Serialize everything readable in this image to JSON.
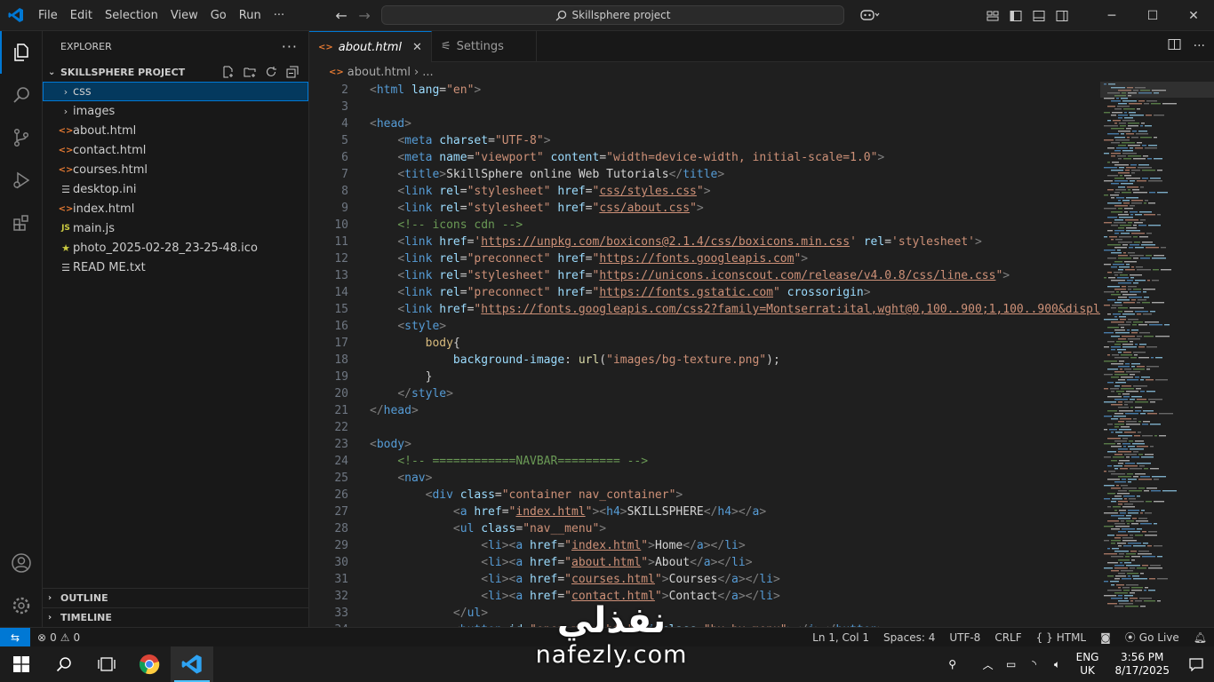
{
  "titlebar": {
    "menu": [
      "File",
      "Edit",
      "Selection",
      "View",
      "Go",
      "Run",
      "···"
    ],
    "search_text": "Skillsphere project"
  },
  "explorer": {
    "title": "EXPLORER",
    "more": "···",
    "project_name": "SKILLSPHERE PROJECT",
    "items": [
      {
        "label": "css",
        "kind": "folder",
        "selected": true
      },
      {
        "label": "images",
        "kind": "folder"
      },
      {
        "label": "about.html",
        "kind": "html"
      },
      {
        "label": "contact.html",
        "kind": "html"
      },
      {
        "label": "courses.html",
        "kind": "html"
      },
      {
        "label": "desktop.ini",
        "kind": "text"
      },
      {
        "label": "index.html",
        "kind": "html"
      },
      {
        "label": "main.js",
        "kind": "js"
      },
      {
        "label": "photo_2025-02-28_23-25-48.ico",
        "kind": "image"
      },
      {
        "label": "READ ME.txt",
        "kind": "text"
      }
    ],
    "outline": "OUTLINE",
    "timeline": "TIMELINE"
  },
  "tabs": [
    {
      "label": "about.html",
      "active": true
    },
    {
      "label": "Settings",
      "active": false
    }
  ],
  "breadcrumb": {
    "file": "about.html",
    "rest": "..."
  },
  "editor": {
    "line_numbers": [
      2,
      3,
      4,
      5,
      6,
      7,
      8,
      9,
      10,
      11,
      12,
      13,
      14,
      15,
      16,
      17,
      18,
      19,
      20,
      21,
      22,
      23,
      24,
      25,
      26,
      27,
      28,
      29,
      30,
      31,
      32,
      33,
      34
    ]
  },
  "statusbar": {
    "errors": "0",
    "warnings": "0",
    "position": "Ln 1, Col 1",
    "spaces": "Spaces: 4",
    "encoding": "UTF-8",
    "eol": "CRLF",
    "language": "HTML",
    "golive": "Go Live"
  },
  "taskbar": {
    "lang_top": "ENG",
    "lang_bottom": "UK",
    "time": "3:56 PM",
    "date": "8/17/2025"
  },
  "watermark": {
    "arabic": "نفذلي",
    "latin": "nafezly.com"
  },
  "colors": {
    "accent": "#0078d4",
    "html_icon": "#e37933",
    "js_icon": "#cbcb41"
  }
}
